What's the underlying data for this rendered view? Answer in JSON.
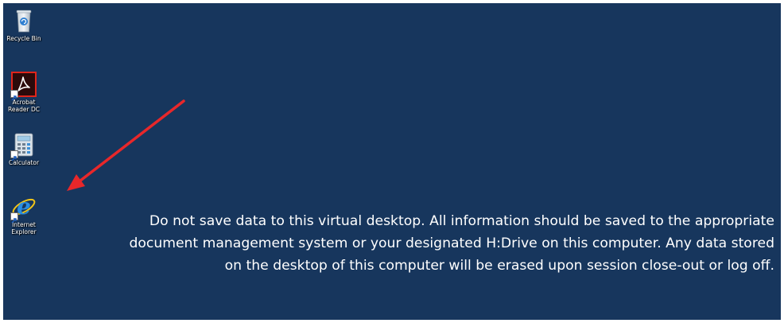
{
  "desktop": {
    "background_color": "#17365d",
    "icons": [
      {
        "label": "Recycle Bin",
        "icon": "recycle-bin-icon"
      },
      {
        "label": "Acrobat\nReader DC",
        "icon": "acrobat-reader-icon"
      },
      {
        "label": "Calculator",
        "icon": "calculator-icon"
      },
      {
        "label": "Internet\nExplorer",
        "icon": "internet-explorer-icon"
      }
    ]
  },
  "notice": {
    "line1": "Do not save data to this virtual desktop. All information should be saved to the appropriate",
    "line2": "document management system or your designated H:Drive on this computer. Any data stored",
    "line3": "on the desktop of this computer will be erased upon session close-out or log off."
  },
  "annotation": {
    "arrow_color": "#e8272a"
  }
}
